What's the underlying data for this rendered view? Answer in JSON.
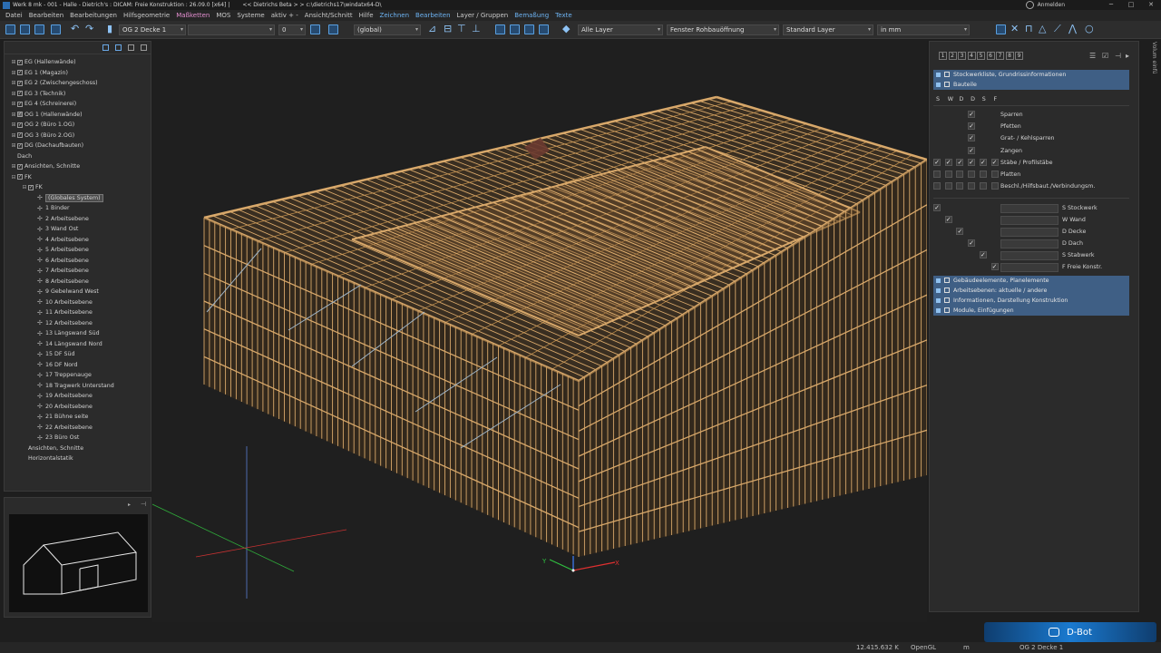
{
  "window": {
    "title": "Werk 8 mk - 001 - Halle - Dietrich's : DICAM: Freie Konstruktion : 26.09.0 [x64] |",
    "subtitle": "<< Dietrichs Beta > > c:\\dietrichs17\\windatx64-D\\",
    "login": "Anmelden"
  },
  "menu": [
    {
      "label": "Datei",
      "color": "normal"
    },
    {
      "label": "Bearbeiten",
      "color": "normal"
    },
    {
      "label": "Bearbeitungen",
      "color": "normal"
    },
    {
      "label": "Hilfsgeometrie",
      "color": "normal"
    },
    {
      "label": "Maßketten",
      "color": "pink"
    },
    {
      "label": "MOS",
      "color": "normal"
    },
    {
      "label": "Systeme",
      "color": "normal"
    },
    {
      "label": "aktiv + -",
      "color": "normal"
    },
    {
      "label": "Ansicht/Schnitt",
      "color": "normal"
    },
    {
      "label": "Hilfe",
      "color": "normal"
    },
    {
      "label": "Zeichnen",
      "color": "blue"
    },
    {
      "label": "Bearbeiten",
      "color": "blue"
    },
    {
      "label": "Layer / Gruppen",
      "color": "normal"
    },
    {
      "label": "Bemaßung",
      "color": "blue"
    },
    {
      "label": "Texte",
      "color": "blue"
    }
  ],
  "toolbar": {
    "floor_select": "OG 2 Decke 1",
    "value_field": "0",
    "coord_system": "(global)",
    "layer_select": "Alle Layer",
    "opening_select": "Fenster Rohbauöffnung",
    "layer_style": "Standard Layer",
    "unit_select": "in mm"
  },
  "tree": {
    "items": [
      {
        "label": "EG (Hallenwände)",
        "checked": true
      },
      {
        "label": "EG 1 (Magazin)",
        "checked": true
      },
      {
        "label": "EG 2 (Zwischengeschoss)",
        "checked": true
      },
      {
        "label": "EG 3 (Technik)",
        "checked": true
      },
      {
        "label": "EG 4 (Schreinerei)",
        "checked": true
      },
      {
        "label": "OG 1 (Hallenwände)",
        "checked": true
      },
      {
        "label": "OG 2 (Büro 1.OG)",
        "checked": true
      },
      {
        "label": "OG 3 (Büro 2.OG)",
        "checked": true
      },
      {
        "label": "DG (Dachaufbauten)",
        "checked": true
      },
      {
        "label": "Dach",
        "checked": false
      },
      {
        "label": "Ansichten, Schnitte",
        "checked": true
      },
      {
        "label": "FK",
        "checked": true
      },
      {
        "label": "FK",
        "checked": true
      },
      {
        "label": "(Globales System)",
        "selected": true
      },
      {
        "label": "1 Binder"
      },
      {
        "label": "2 Arbeitsebene"
      },
      {
        "label": "3 Wand Ost"
      },
      {
        "label": "4 Arbeitsebene"
      },
      {
        "label": "5 Arbeitsebene"
      },
      {
        "label": "6 Arbeitsebene"
      },
      {
        "label": "7 Arbeitsebene"
      },
      {
        "label": "8 Arbeitsebene"
      },
      {
        "label": "9 Gebelwand West"
      },
      {
        "label": "10 Arbeitsebene"
      },
      {
        "label": "11 Arbeitsebene"
      },
      {
        "label": "12 Arbeitsebene"
      },
      {
        "label": "13 Längswand Süd"
      },
      {
        "label": "14 Längswand Nord"
      },
      {
        "label": "15 DF Süd"
      },
      {
        "label": "16 DF Nord"
      },
      {
        "label": "17 Treppenauge"
      },
      {
        "label": "18 Tragwerk Unterstand"
      },
      {
        "label": "19 Arbeitsebene"
      },
      {
        "label": "20 Arbeitsebene"
      },
      {
        "label": "21 Bühne seite"
      },
      {
        "label": "22 Arbeitsebene"
      },
      {
        "label": "23 Büro Ost"
      },
      {
        "label": "Ansichten, Schnitte"
      },
      {
        "label": "Horizontalstatik"
      }
    ]
  },
  "layers": {
    "tabs": [
      "1",
      "2",
      "3",
      "4",
      "5",
      "6",
      "7",
      "8",
      "9"
    ],
    "sections_top": [
      {
        "label": "Stockwerkliste, Grundrissinformationen"
      },
      {
        "label": "Bauteile"
      }
    ],
    "columns": [
      "S",
      "W",
      "D",
      "D",
      "S",
      "F"
    ],
    "components": [
      {
        "label": "Sparren"
      },
      {
        "label": "Pfetten"
      },
      {
        "label": "Grat- / Kehlsparren"
      },
      {
        "label": "Zangen"
      },
      {
        "label": "Stäbe / Profilstäbe"
      },
      {
        "label": "Platten"
      },
      {
        "label": "Beschl./Hilfsbaut./Verbindungsm."
      }
    ],
    "types": [
      {
        "label": "S Stockwerk"
      },
      {
        "label": "W Wand"
      },
      {
        "label": "D Decke"
      },
      {
        "label": "D Dach"
      },
      {
        "label": "S Stabwerk"
      },
      {
        "label": "F Freie Konstr."
      }
    ],
    "sections_bottom": [
      {
        "label": "Gebäudeelemente, Planelemente"
      },
      {
        "label": "Arbeitsebenen: aktuelle / andere"
      },
      {
        "label": "Informationen, Darstellung Konstruktion"
      },
      {
        "label": "Module, Einfügungen"
      }
    ],
    "side_tab": "Volum einfü"
  },
  "dbot": {
    "label": "D-Bot"
  },
  "status": {
    "coordinate": "12.415.632 K",
    "renderer": "OpenGL",
    "unit": "m",
    "floor": "OG 2 Decke 1"
  },
  "colors": {
    "accent": "#3f5f85",
    "wood": "#d8a86a",
    "axis_x": "#e03030",
    "axis_y": "#30c040",
    "axis_z": "#4080ff"
  }
}
